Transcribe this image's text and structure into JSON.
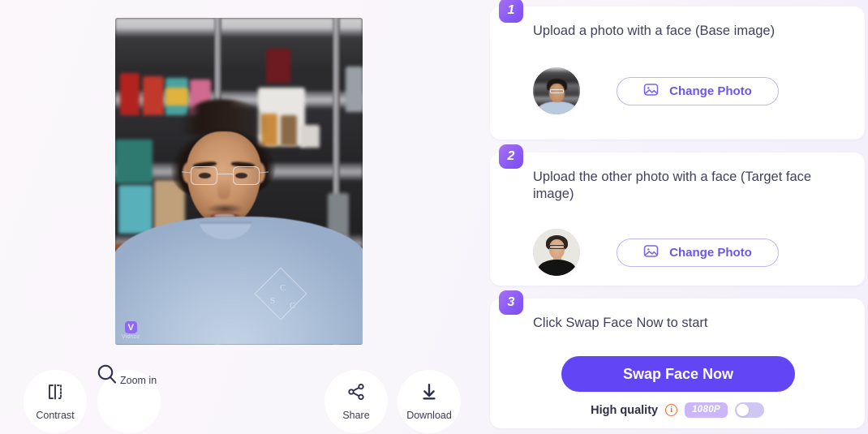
{
  "preview": {
    "watermark_logo": "V",
    "watermark_text": "Vidnoz",
    "photo_alt": "man-with-glasses-in-store"
  },
  "toolbar": {
    "buttons": [
      {
        "label": "Contrast",
        "icon": "contrast-icon"
      },
      {
        "label": "Zoom in",
        "icon": "magnifier-icon"
      },
      {
        "label": "Share",
        "icon": "share-icon"
      },
      {
        "label": "Download",
        "icon": "download-icon"
      }
    ]
  },
  "steps": [
    {
      "number": "1",
      "title": "Upload a photo with a face (Base image)",
      "change_label": "Change Photo",
      "avatar_alt": "base-face-thumbnail"
    },
    {
      "number": "2",
      "title": "Upload the other photo with a face (Target face image)",
      "change_label": "Change Photo",
      "avatar_alt": "target-face-thumbnail"
    },
    {
      "number": "3",
      "title": "Click Swap Face Now to start",
      "swap_label": "Swap Face Now",
      "quality_label": "High quality",
      "resolution_badge": "1080P",
      "info_glyph": "i",
      "toggle_state": "off"
    }
  ],
  "colors": {
    "accent": "#6246f5",
    "badge_gradient_start": "#a970f0",
    "badge_gradient_end": "#7c4dee",
    "outline_button_text": "#6d55e8",
    "outline_button_border": "#c2b5f4",
    "resolution_badge_bg": "#cbb7f7",
    "info_icon": "#f2692c",
    "title_text": "#41415e",
    "page_background": "#f7f4fb"
  }
}
